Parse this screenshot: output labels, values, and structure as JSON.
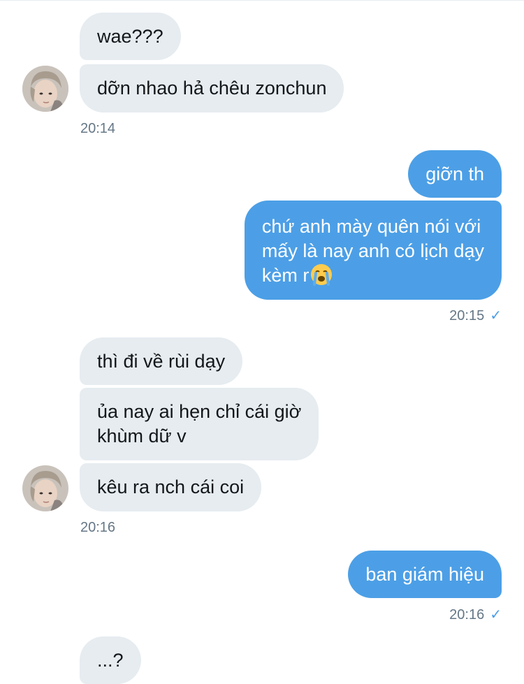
{
  "messages": [
    {
      "id": "m1",
      "direction": "incoming",
      "text": "wae???"
    },
    {
      "id": "m2",
      "direction": "incoming",
      "text": "dỡn nhao hả chêu zonchun"
    },
    {
      "id": "m3",
      "direction": "outgoing",
      "text": "giỡn th"
    },
    {
      "id": "m4",
      "direction": "outgoing",
      "lines": [
        "chứ anh mày quên nói với",
        "mấy là nay anh có lịch dạy",
        "kèm r"
      ],
      "emoji": "loudly-crying-face"
    },
    {
      "id": "m5",
      "direction": "incoming",
      "text": "thì đi về rùi dạy"
    },
    {
      "id": "m6",
      "direction": "incoming",
      "lines": [
        "ủa nay ai hẹn chỉ cái giờ",
        "khùm dữ v"
      ]
    },
    {
      "id": "m7",
      "direction": "incoming",
      "text": "kêu ra nch cái coi"
    },
    {
      "id": "m8",
      "direction": "outgoing",
      "text": "ban giám hiệu"
    },
    {
      "id": "m9",
      "direction": "incoming",
      "text": "...?"
    }
  ],
  "timestamps": {
    "t1": "20:14",
    "t2": "20:15",
    "t3": "20:16",
    "t4": "20:16"
  },
  "icons": {
    "read_receipt": "checkmark-icon",
    "avatar": "contact-avatar"
  },
  "colors": {
    "incoming_bubble": "#e6ecf0",
    "outgoing_bubble": "#4c9fe6",
    "timestamp": "#657786",
    "text_dark": "#14171a"
  }
}
